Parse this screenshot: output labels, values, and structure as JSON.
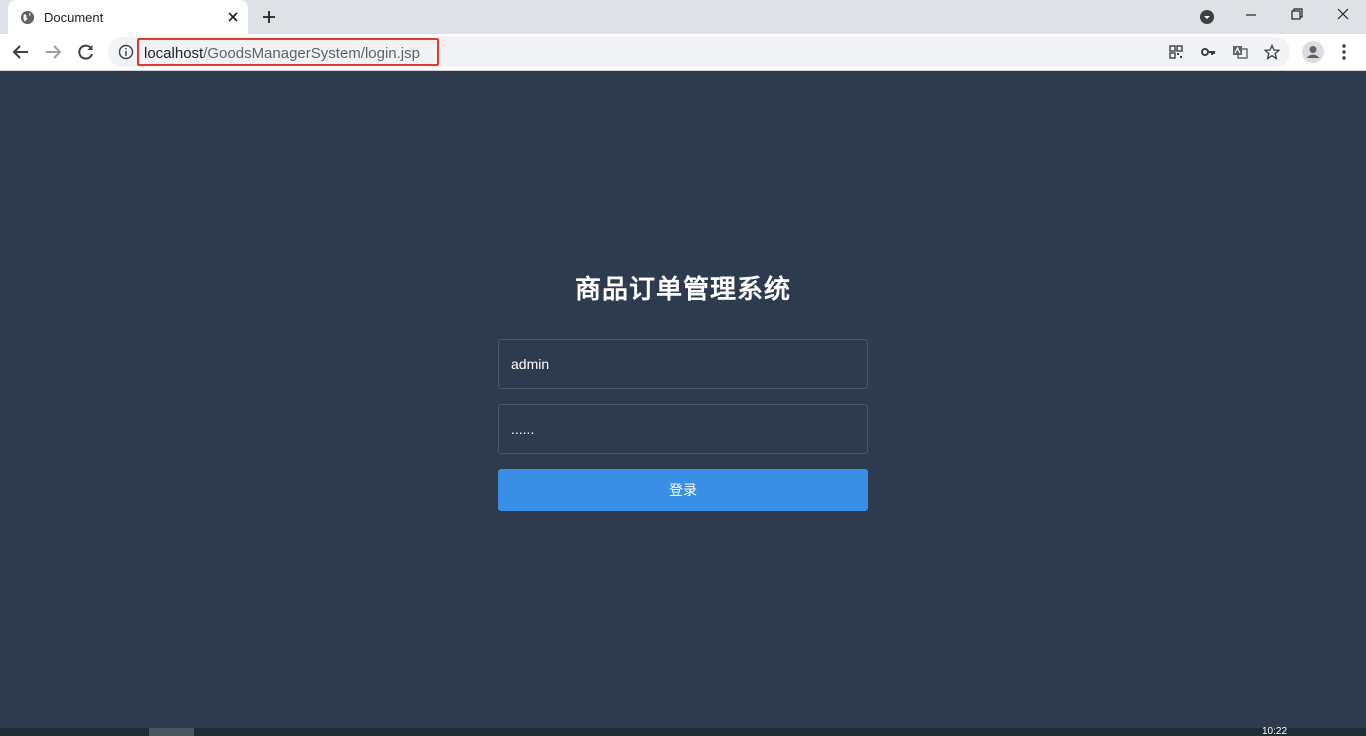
{
  "browser": {
    "tab_title": "Document",
    "url_host": "localhost",
    "url_path": "/GoodsManagerSystem/login.jsp"
  },
  "login": {
    "title": "商品订单管理系统",
    "username_value": "admin",
    "password_value": "......",
    "submit_label": "登录"
  },
  "taskbar": {
    "clock": "10:22"
  },
  "colors": {
    "page_background": "#2e3a4d",
    "button_primary": "#3a8ee6",
    "highlight_box": "#e53935"
  }
}
